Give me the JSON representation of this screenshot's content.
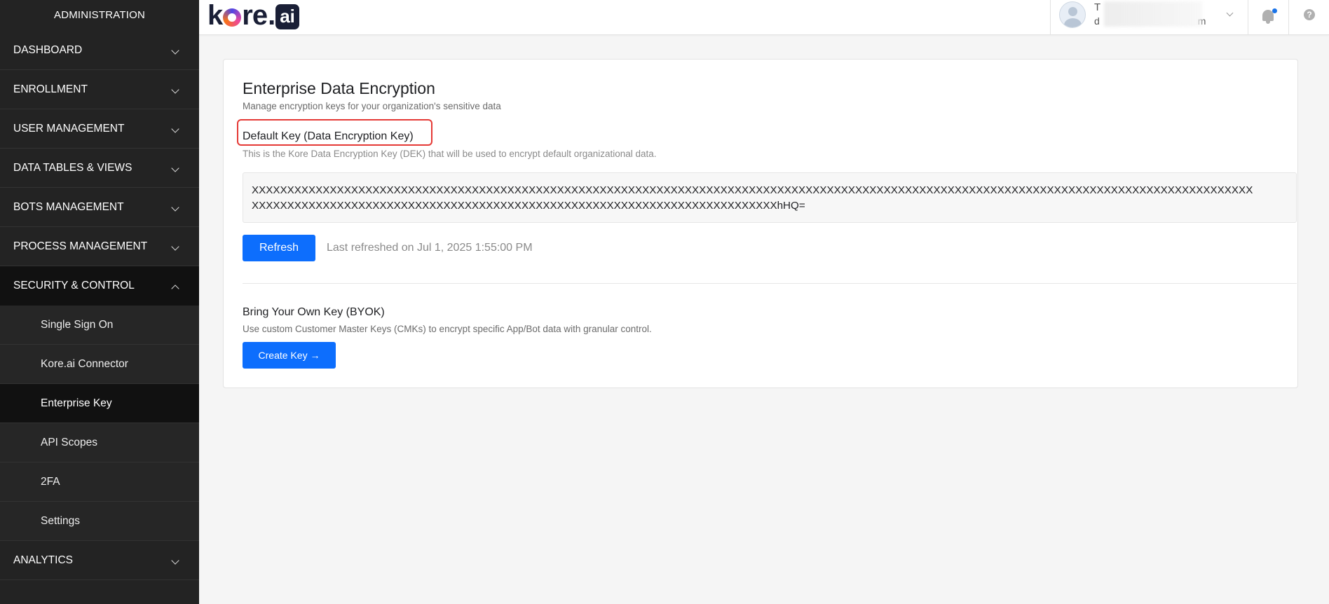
{
  "sidebar": {
    "title": "ADMINISTRATION",
    "items": [
      {
        "label": "DASHBOARD"
      },
      {
        "label": "ENROLLMENT"
      },
      {
        "label": "USER MANAGEMENT"
      },
      {
        "label": "DATA TABLES & VIEWS"
      },
      {
        "label": "BOTS MANAGEMENT"
      },
      {
        "label": "PROCESS MANAGEMENT"
      },
      {
        "label": "SECURITY & CONTROL",
        "expanded": true
      },
      {
        "label": "ANALYTICS"
      }
    ],
    "security_sub_items": [
      {
        "label": "Single Sign On"
      },
      {
        "label": "Kore.ai Connector"
      },
      {
        "label": "Enterprise Key",
        "active": true
      },
      {
        "label": "API Scopes"
      },
      {
        "label": "2FA"
      },
      {
        "label": "Settings"
      }
    ]
  },
  "header": {
    "logo": {
      "text_before": "k",
      "text_after": "re",
      "dot": ".",
      "ai": "ai"
    },
    "user": {
      "name": "T",
      "email": "d",
      "email_suffix": "m"
    },
    "accent_color": "#1a73e8"
  },
  "main": {
    "title": "Enterprise Data Encryption",
    "subtitle": "Manage encryption keys for your organization's sensitive data",
    "default_key": {
      "title": "Default Key (Data Encryption Key)",
      "description": "This is the Kore Data Encryption Key (DEK) that will be used to encrypt default organizational data.",
      "key_line1": "XXXXXXXXXXXXXXXXXXXXXXXXXXXXXXXXXXXXXXXXXXXXXXXXXXXXXXXXXXXXXXXXXXXXXXXXXXXXXXXXXXXXXXXXXXXXXXXXXXXXXXXXXXXXXXXXXXXXXXXXXXXXXXXXXXXXXXXXXXXXX",
      "key_line2": "XXXXXXXXXXXXXXXXXXXXXXXXXXXXXXXXXXXXXXXXXXXXXXXXXXXXXXXXXXXXXXXXXXXXXXXXXXhHQ=",
      "refresh_label": "Refresh",
      "last_refreshed": "Last refreshed on Jul 1, 2025 1:55:00 PM"
    },
    "byok": {
      "title": "Bring Your Own Key (BYOK)",
      "description": "Use custom Customer Master Keys (CMKs) to encrypt specific App/Bot data with granular control.",
      "create_label": "Create Key →"
    },
    "button_color": "#0d6efd",
    "highlight_color": "#e53935"
  }
}
